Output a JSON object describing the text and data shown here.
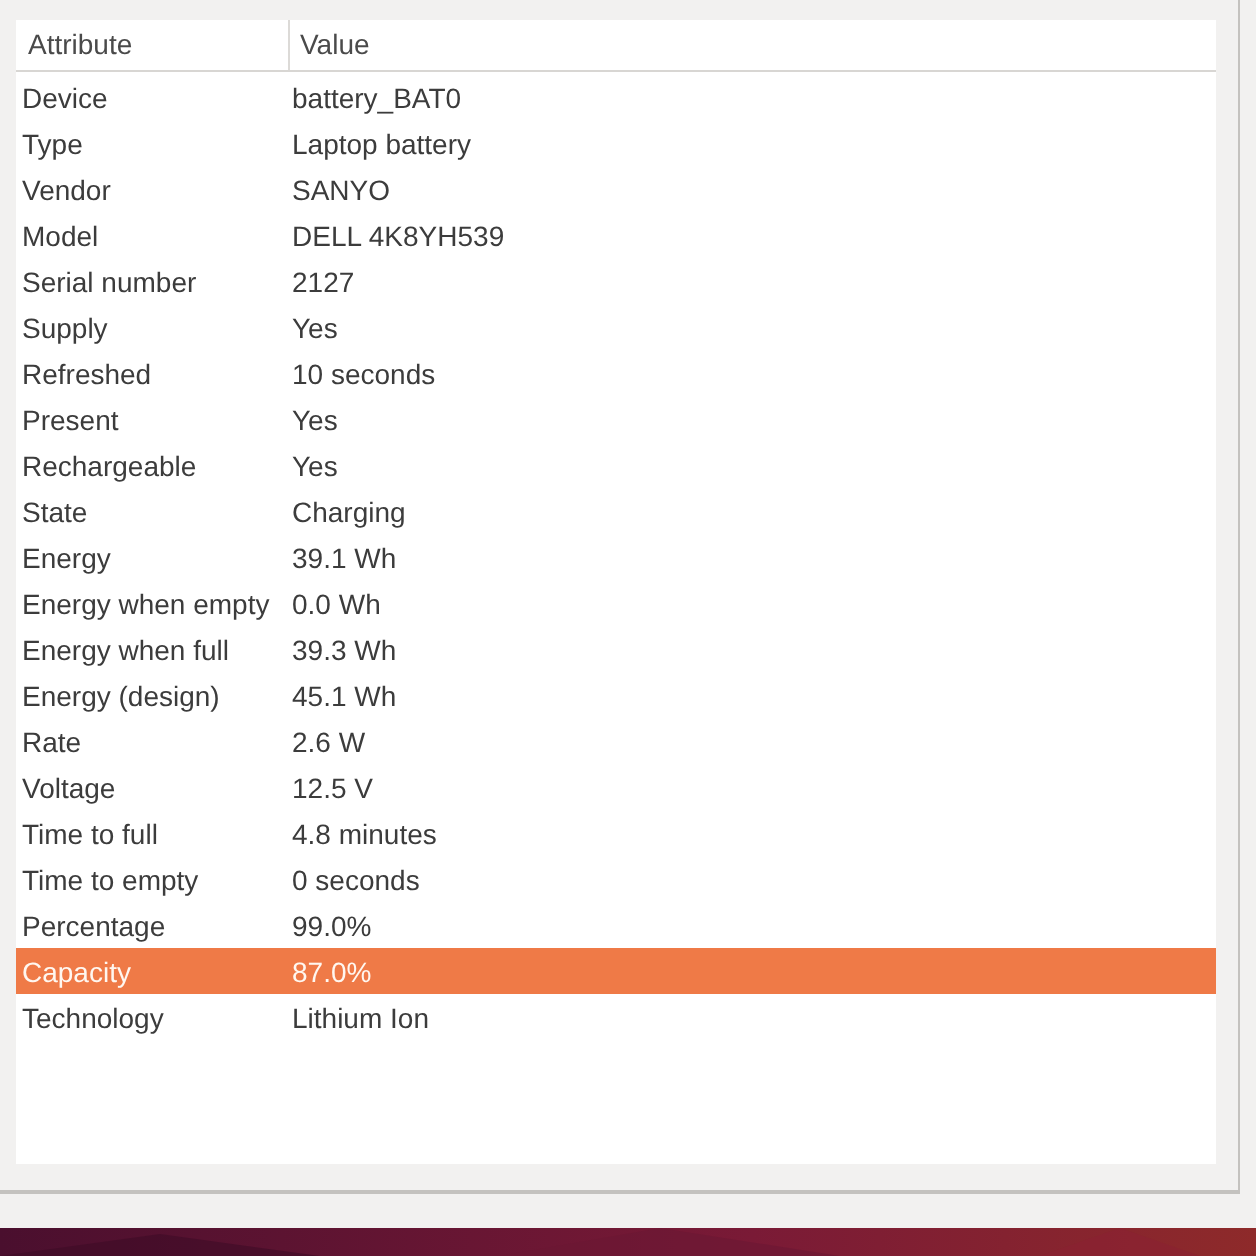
{
  "table": {
    "columns": [
      "Attribute",
      "Value"
    ],
    "rows": [
      {
        "attribute": "Device",
        "value": "battery_BAT0",
        "selected": false
      },
      {
        "attribute": "Type",
        "value": "Laptop battery",
        "selected": false
      },
      {
        "attribute": "Vendor",
        "value": "SANYO",
        "selected": false
      },
      {
        "attribute": "Model",
        "value": "DELL 4K8YH539",
        "selected": false
      },
      {
        "attribute": "Serial number",
        "value": "2127",
        "selected": false
      },
      {
        "attribute": "Supply",
        "value": "Yes",
        "selected": false
      },
      {
        "attribute": "Refreshed",
        "value": "10 seconds",
        "selected": false
      },
      {
        "attribute": "Present",
        "value": "Yes",
        "selected": false
      },
      {
        "attribute": "Rechargeable",
        "value": "Yes",
        "selected": false
      },
      {
        "attribute": "State",
        "value": "Charging",
        "selected": false
      },
      {
        "attribute": "Energy",
        "value": "39.1 Wh",
        "selected": false
      },
      {
        "attribute": "Energy when empty",
        "value": "0.0 Wh",
        "selected": false
      },
      {
        "attribute": "Energy when full",
        "value": "39.3 Wh",
        "selected": false
      },
      {
        "attribute": "Energy (design)",
        "value": "45.1 Wh",
        "selected": false
      },
      {
        "attribute": "Rate",
        "value": "2.6 W",
        "selected": false
      },
      {
        "attribute": "Voltage",
        "value": "12.5 V",
        "selected": false
      },
      {
        "attribute": "Time to full",
        "value": "4.8 minutes",
        "selected": false
      },
      {
        "attribute": "Time to empty",
        "value": "0 seconds",
        "selected": false
      },
      {
        "attribute": "Percentage",
        "value": "99.0%",
        "selected": false
      },
      {
        "attribute": "Capacity",
        "value": "87.0%",
        "selected": true
      },
      {
        "attribute": "Technology",
        "value": "Lithium Ion",
        "selected": false
      }
    ]
  }
}
